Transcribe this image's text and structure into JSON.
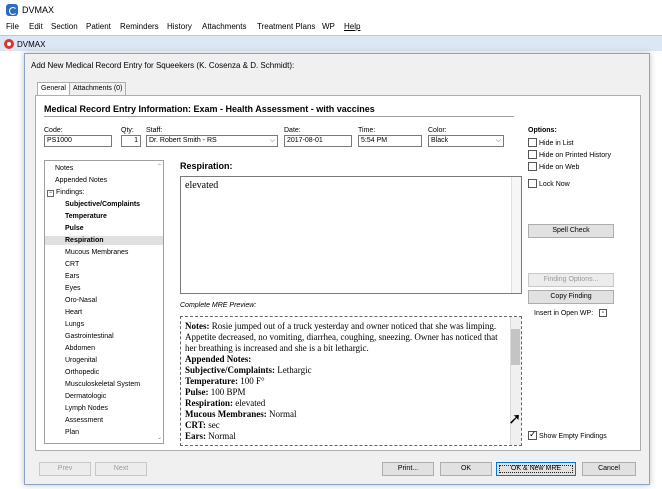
{
  "app": {
    "title": "DVMAX",
    "inner_title": "DVMAX"
  },
  "menu": [
    "File",
    "Edit",
    "Section",
    "Patient",
    "Reminders",
    "History",
    "Attachments",
    "Treatment Plans",
    "WP",
    "Help"
  ],
  "dialog": {
    "title": "Add New Medical Record Entry for Squeekers (K. Cosenza & D. Schmidt):",
    "tabs": [
      "General",
      "Attachments (0)"
    ],
    "heading": "Medical Record Entry Information:  Exam - Health Assessment - with vaccines",
    "fields": {
      "code_label": "Code:",
      "code_value": "PS1000",
      "qty_label": "Qty:",
      "qty_value": "1",
      "staff_label": "Staff:",
      "staff_value": "Dr. Robert Smith - RS",
      "date_label": "Date:",
      "date_value": "2017-08-01",
      "time_label": "Time:",
      "time_value": "5:54 PM",
      "color_label": "Color:",
      "color_value": "Black"
    },
    "options": {
      "title": "Options:",
      "items": [
        {
          "label": "Hide in List",
          "checked": false
        },
        {
          "label": "Hide on Printed History",
          "checked": false
        },
        {
          "label": "Hide on Web",
          "checked": false
        },
        {
          "label": "Lock Now",
          "checked": false
        }
      ]
    },
    "tree": {
      "top_items": [
        "Notes",
        "Appended Notes"
      ],
      "findings_label": "Findings:",
      "findings": [
        {
          "label": "Subjective/Complaints",
          "bold": true
        },
        {
          "label": "Temperature",
          "bold": true
        },
        {
          "label": "Pulse",
          "bold": true
        },
        {
          "label": "Respiration",
          "bold": true,
          "selected": true
        },
        {
          "label": "Mucous Membranes",
          "bold": false
        },
        {
          "label": "CRT",
          "bold": false
        },
        {
          "label": "Ears",
          "bold": false
        },
        {
          "label": "Eyes",
          "bold": false
        },
        {
          "label": "Oro-Nasal",
          "bold": false
        },
        {
          "label": "Heart",
          "bold": false
        },
        {
          "label": "Lungs",
          "bold": false
        },
        {
          "label": "Gastrointestinal",
          "bold": false
        },
        {
          "label": "Abdomen",
          "bold": false
        },
        {
          "label": "Urogenital",
          "bold": false
        },
        {
          "label": "Orthopedic",
          "bold": false
        },
        {
          "label": "Musculoskeletal System",
          "bold": false
        },
        {
          "label": "Dermatologic",
          "bold": false
        },
        {
          "label": "Lymph Nodes",
          "bold": false
        },
        {
          "label": "Assessment",
          "bold": false
        },
        {
          "label": "Plan",
          "bold": false
        }
      ]
    },
    "editor": {
      "label": "Respiration:",
      "value": "elevated"
    },
    "preview": {
      "label": "Complete MRE Preview:",
      "notes_label": "Notes:",
      "notes_text": " Rosie jumped out of a truck yesterday and owner noticed that she was limping.  Appetite decreased, no vomiting, diarrhea, coughing, sneezing.  Owner has noticed that her breathing is increased and she is a bit lethargic.",
      "appended_label": "Appended Notes:",
      "lines": [
        {
          "label": "Subjective/Complaints:",
          "value": " Lethargic"
        },
        {
          "label": "Temperature:",
          "value": " 100 F°"
        },
        {
          "label": "Pulse:",
          "value": " 100 BPM"
        },
        {
          "label": "Respiration:",
          "value": " elevated"
        },
        {
          "label": "Mucous Membranes:",
          "value": " Normal"
        },
        {
          "label": "CRT:",
          "value": "  sec"
        },
        {
          "label": "Ears:",
          "value": " Normal"
        }
      ]
    },
    "side_buttons": {
      "spell_check": "Spell Check",
      "finding_options": "Finding Options...",
      "copy_finding": "Copy Finding",
      "insert_wp_label": "Insert in Open WP:",
      "show_empty_label": "Show Empty Findings",
      "show_empty_checked": true
    },
    "bottom_buttons": {
      "prev": "Prev",
      "next": "Next",
      "print": "Print...",
      "ok": "OK",
      "ok_new": "OK & New MRE",
      "cancel": "Cancel"
    }
  }
}
